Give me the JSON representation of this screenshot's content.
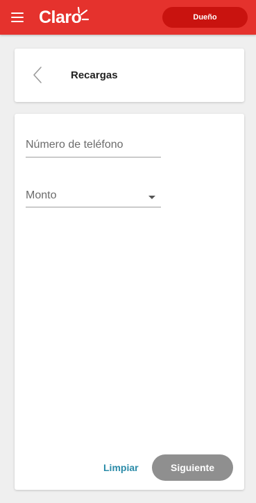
{
  "header": {
    "brand": "Claro",
    "role_button": "Dueño",
    "colors": {
      "primary": "#e5322d",
      "role_button_bg": "#c9130f"
    }
  },
  "page": {
    "title": "Recargas",
    "back_icon": "chevron-left-icon"
  },
  "form": {
    "phone_field": {
      "placeholder": "Número de teléfono",
      "value": ""
    },
    "amount_field": {
      "placeholder": "Monto",
      "value": "",
      "icon": "dropdown-arrow-icon"
    },
    "clear_label": "Limpiar",
    "next_label": "Siguiente",
    "colors": {
      "clear": "#2a8ba8",
      "next_disabled": "#8f8f8f"
    }
  }
}
